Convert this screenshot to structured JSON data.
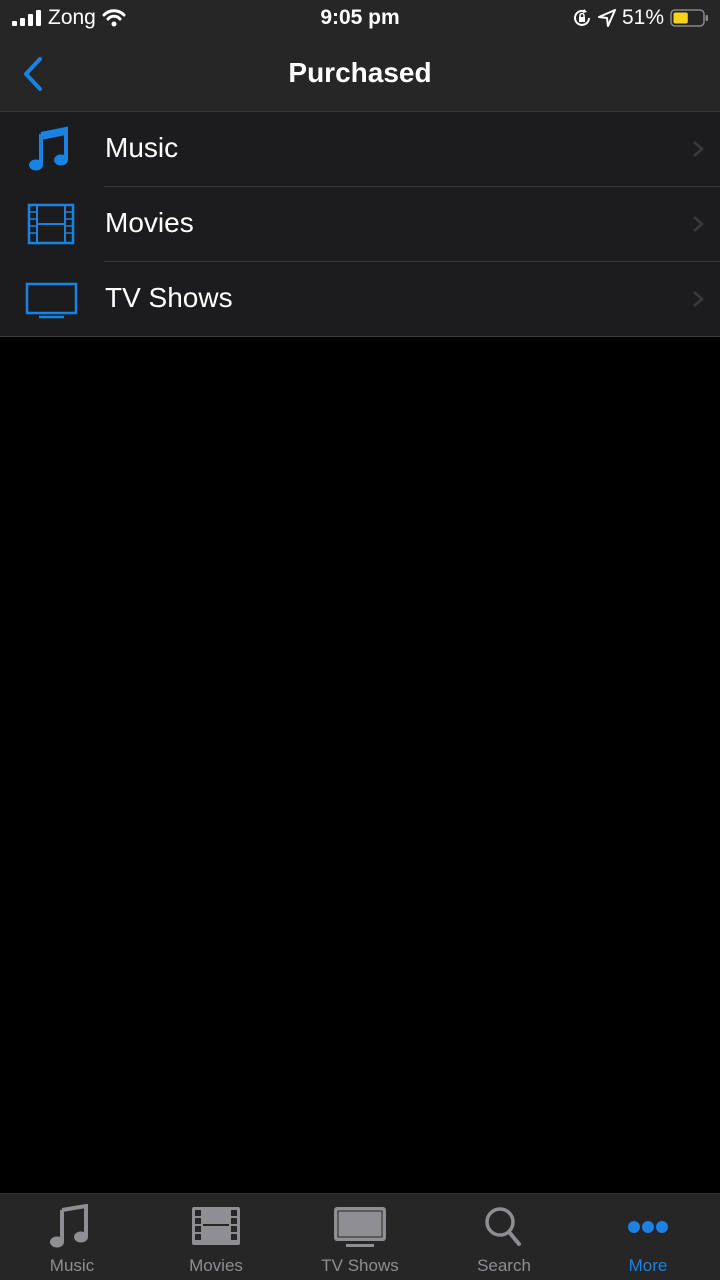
{
  "status_bar": {
    "carrier": "Zong",
    "time": "9:05 pm",
    "battery_percent": "51%",
    "battery_level": 0.51,
    "icons": [
      "signal-icon",
      "wifi-icon",
      "orientation-lock-icon",
      "location-icon",
      "battery-icon"
    ]
  },
  "nav": {
    "title": "Purchased",
    "back_icon": "chevron-left-icon"
  },
  "list": {
    "items": [
      {
        "label": "Music",
        "icon": "music-note-icon"
      },
      {
        "label": "Movies",
        "icon": "film-icon"
      },
      {
        "label": "TV Shows",
        "icon": "tv-icon"
      }
    ]
  },
  "tabbar": {
    "tabs": [
      {
        "label": "Music",
        "icon": "music-note-icon",
        "active": false
      },
      {
        "label": "Movies",
        "icon": "film-icon",
        "active": false
      },
      {
        "label": "TV Shows",
        "icon": "tv-icon",
        "active": false
      },
      {
        "label": "Search",
        "icon": "search-icon",
        "active": false
      },
      {
        "label": "More",
        "icon": "more-icon",
        "active": true
      }
    ]
  },
  "colors": {
    "accent": "#1a82e2",
    "inactive": "#8e8e93",
    "battery": "#f7d31a"
  }
}
